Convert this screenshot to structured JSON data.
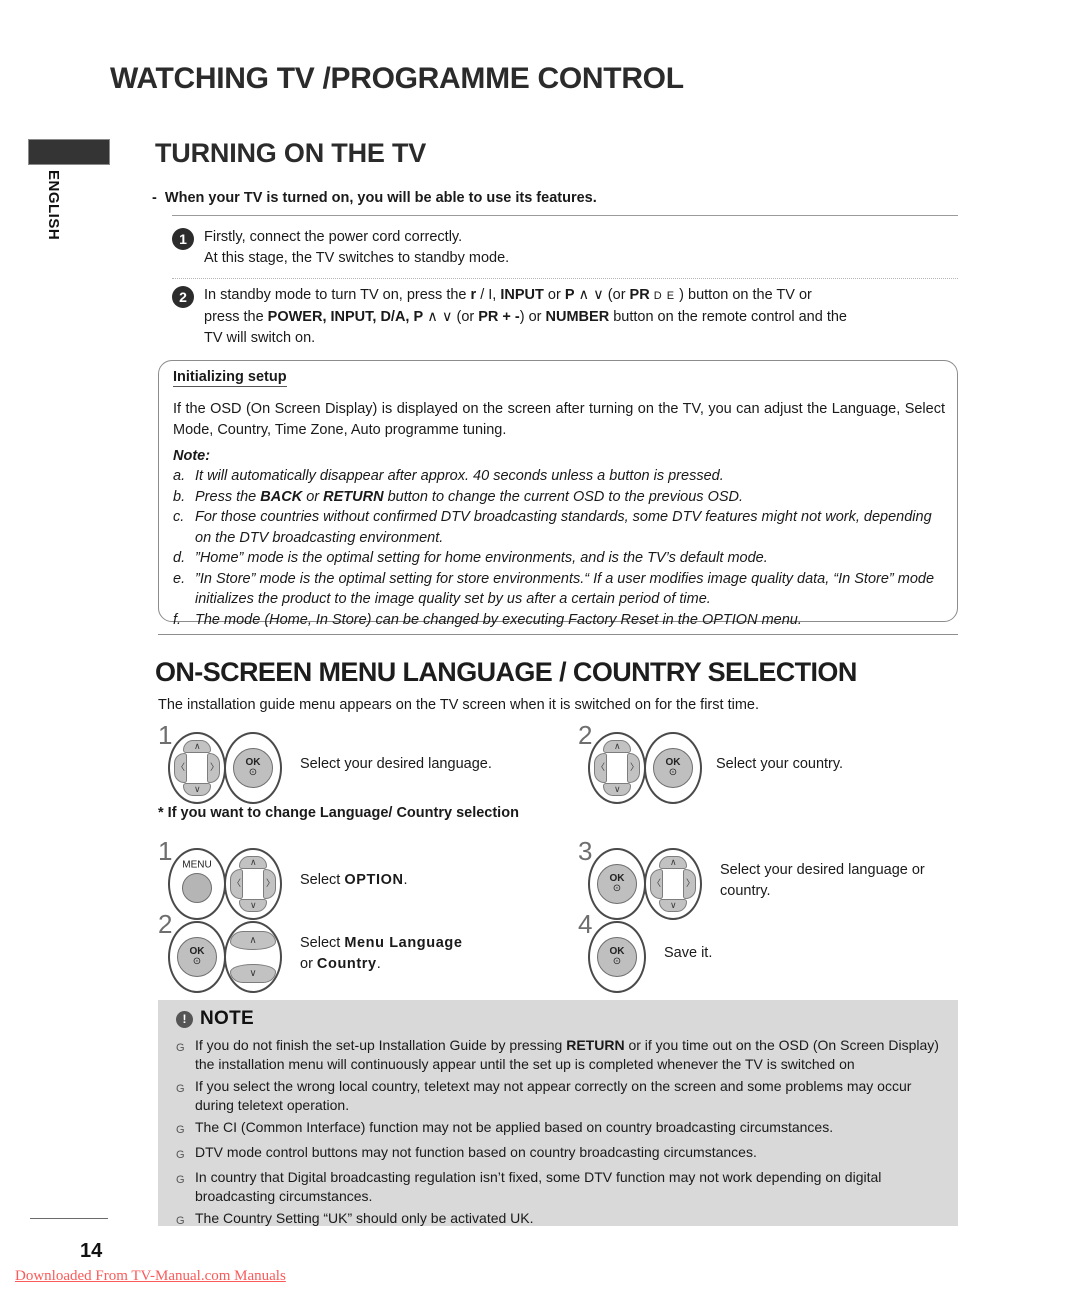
{
  "sidebar": {
    "language_tab": "ENGLISH"
  },
  "header": {
    "chapter_title": "WATCHING TV /PROGRAMME CONTROL",
    "section_title": "TURNING ON THE TV",
    "section_title_2": "ON-SCREEN MENU LANGUAGE / COUNTRY SELECTION"
  },
  "turning_on": {
    "intro_dash": "-",
    "intro": "When your TV is turned on, you will be able to use its features.",
    "steps": [
      {
        "num": "1",
        "line1": "Firstly, connect the power cord correctly.",
        "line2": "At this stage, the TV switches to standby mode."
      },
      {
        "num": "2",
        "parts": {
          "a": "In standby mode to turn TV on, press the ",
          "power_glyph": "r",
          "b": " / I, ",
          "input": "INPUT",
          "c": " or ",
          "p": "P",
          "updown1": " ∧ ∨ ",
          "d": "(or ",
          "pr1": "PR",
          "de": " D E ",
          "e": ") button on the TV or",
          "f": "press the ",
          "power": "POWER, INPUT, D/A, P",
          "updown2": " ∧ ∨ ",
          "g": "(or ",
          "pr2": "PR",
          "plusminus": " + -",
          "h": ") or ",
          "number": "NUMBER",
          "i": " button on the remote control and the",
          "j": "TV will switch on."
        }
      }
    ]
  },
  "init_box": {
    "heading": "Initializing setup",
    "body": "If the OSD (On Screen Display) is displayed on the screen after turning on the TV, you can adjust the Language, Select Mode, Country, Time Zone, Auto programme tuning.",
    "note_label": "Note:",
    "notes": [
      {
        "label": "a.",
        "text": "It will automatically disappear after approx. 40 seconds unless a button is pressed."
      },
      {
        "label": "b.",
        "pre": "Press the ",
        "bold1": "BACK",
        "mid": " or ",
        "bold2": "RETURN",
        "post": " button to change the current OSD to the previous OSD."
      },
      {
        "label": "c.",
        "text": "For those countries without confirmed DTV broadcasting standards, some DTV features might not work, depending on the DTV broadcasting environment."
      },
      {
        "label": "d.",
        "text": "”Home” mode is the optimal setting for home environments, and is the TV’s default mode."
      },
      {
        "label": "e.",
        "text": "”In Store” mode is the optimal setting for store environments.“ If a user modifies image quality data, “In Store” mode initializes the product to the image quality set by us after a certain period of time."
      },
      {
        "label": "f.",
        "text": "The mode (Home, In Store) can be changed by executing Factory Reset in the OPTION menu."
      }
    ]
  },
  "osd_section": {
    "intro": "The installation guide menu appears on the TV screen when it is switched on for the first time.",
    "first_time_steps": [
      {
        "num": "1",
        "label": "Select your desired language."
      },
      {
        "num": "2",
        "label": "Select your country."
      }
    ],
    "change_heading": "* If you want to change Language/ Country selection",
    "change_steps": [
      {
        "num": "1",
        "label_pre": "Select ",
        "label_bold": "OPTION",
        "label_post": "."
      },
      {
        "num": "2",
        "label_pre": "Select ",
        "label_bold": "Menu Language",
        "label_pre2": "or ",
        "label_bold2": "Country",
        "label_post": "."
      },
      {
        "num": "3",
        "label_line1": "Select your desired language or",
        "label_line2": "country."
      },
      {
        "num": "4",
        "label": "Save it."
      }
    ],
    "keys": {
      "ok_label": "OK",
      "ok_dot": "⊙",
      "menu_label": "MENU",
      "up_glyph": "∧",
      "down_glyph": "∨",
      "left_glyph": "〈",
      "right_glyph": "〉"
    }
  },
  "note_panel": {
    "icon": "!",
    "title": "NOTE",
    "bullet": "G",
    "items": [
      {
        "pre": "If you do not finish the set-up Installation Guide by pressing ",
        "bold": "RETURN",
        "post": " or if you time out on the OSD (On Screen Display) the installation menu will continuously appear until the set up is completed whenever the TV is switched on"
      },
      {
        "pre": "If you select the wrong local country, teletext may not appear correctly on the screen and some problems may occur during teletext operation.",
        "bold": "",
        "post": ""
      },
      {
        "pre": "The CI (Common Interface) function may not be applied based on country broadcasting circumstances.",
        "bold": "",
        "post": ""
      },
      {
        "pre": "DTV mode control buttons may not function based on country broadcasting circumstances.",
        "bold": "",
        "post": ""
      },
      {
        "pre": "In country that Digital broadcasting regulation isn’t fixed, some DTV function may not work depending on digital broadcasting circumstances.",
        "bold": "",
        "post": ""
      },
      {
        "pre": "The Country Setting “UK” should only be activated UK.",
        "bold": "",
        "post": ""
      }
    ]
  },
  "footer": {
    "page_number": "14",
    "download_text": "Downloaded From TV-Manual.com Manuals"
  },
  "colors": {
    "note_bg": "#d9d9d9",
    "link": "#fb5a5a",
    "key_gray": "#c2c2c2"
  }
}
